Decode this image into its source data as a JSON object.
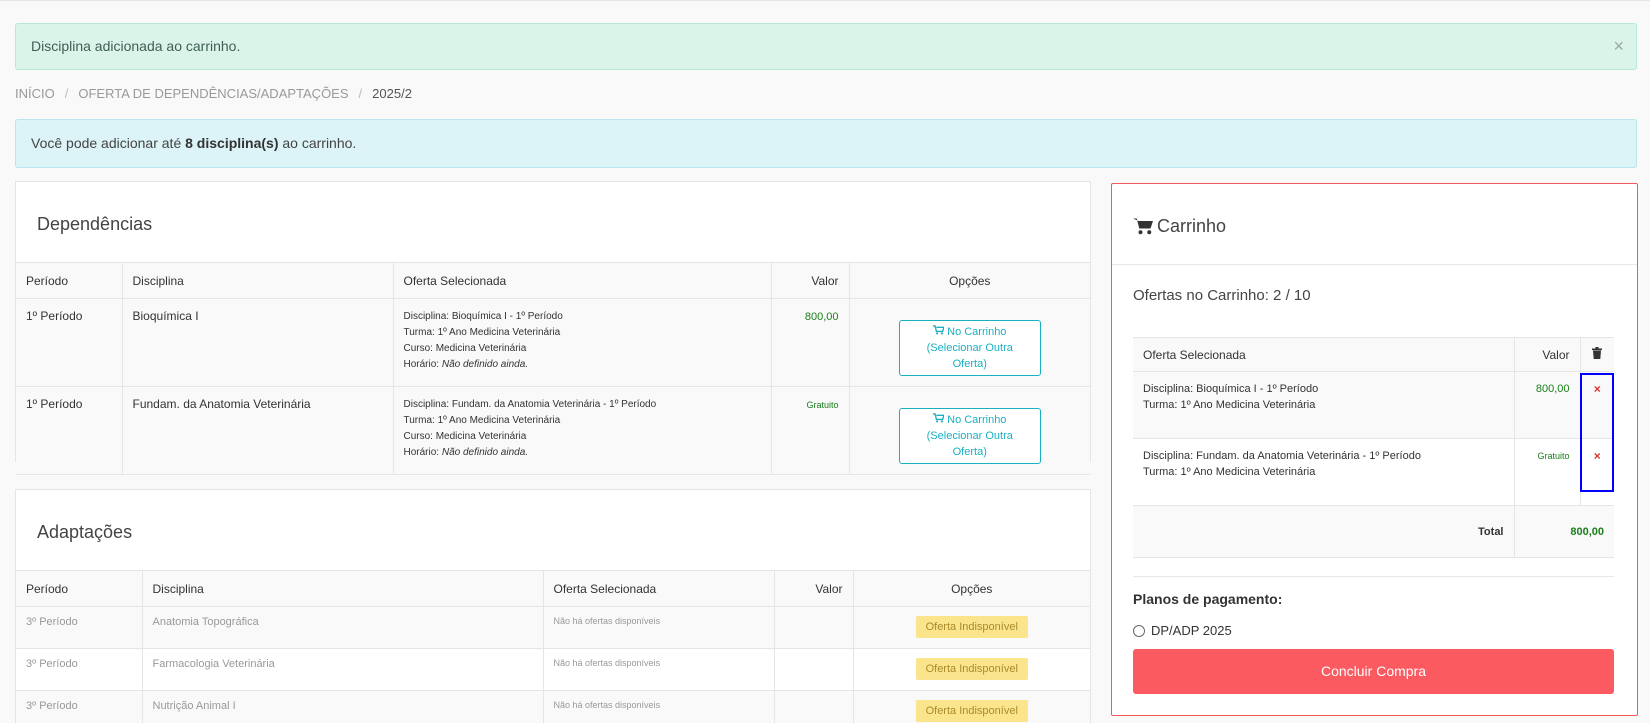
{
  "alert_success": {
    "text": "Disciplina adicionada ao carrinho.",
    "close_glyph": "×"
  },
  "breadcrumb": [
    "INÍCIO",
    "OFERTA DE DEPENDÊNCIAS/ADAPTAÇÕES",
    "2025/2"
  ],
  "breadcrumb_sep": "/",
  "info": {
    "prefix": "Você pode adicionar até ",
    "bold": "8 disciplina(s)",
    "suffix": " ao carrinho."
  },
  "dependencias": {
    "title": "Dependências",
    "headers": [
      "Período",
      "Disciplina",
      "Oferta Selecionada",
      "Valor",
      "Opções"
    ],
    "rows": [
      {
        "periodo": "1º Período",
        "disciplina": "Bioquímica I",
        "oferta": {
          "disciplina": "Disciplina: Bioquímica I - 1º Período",
          "turma": "Turma: 1º Ano Medicina Veterinária",
          "curso": "Curso: Medicina Veterinária",
          "horario_label": "Horário: ",
          "horario_value": "Não definido ainda."
        },
        "valor": "800,00",
        "btn_line1": "No Carrinho",
        "btn_line2": "(Selecionar Outra Oferta)"
      },
      {
        "periodo": "1º Período",
        "disciplina": "Fundam. da Anatomia Veterinária",
        "oferta": {
          "disciplina": "Disciplina: Fundam. da Anatomia Veterinária - 1º Período",
          "turma": "Turma: 1º Ano Medicina Veterinária",
          "curso": "Curso: Medicina Veterinária",
          "horario_label": "Horário: ",
          "horario_value": "Não definido ainda."
        },
        "valor": "Gratuito",
        "btn_line1": "No Carrinho",
        "btn_line2": "(Selecionar Outra Oferta)"
      }
    ]
  },
  "adaptacoes": {
    "title": "Adaptações",
    "headers": [
      "Período",
      "Disciplina",
      "Oferta Selecionada",
      "Valor",
      "Opções"
    ],
    "rows": [
      {
        "periodo": "3º Período",
        "disciplina": "Anatomia Topográfica",
        "oferta": "Não há ofertas disponíveis",
        "valor": "",
        "opcao": "Oferta Indisponível"
      },
      {
        "periodo": "3º Período",
        "disciplina": "Farmacologia Veterinária",
        "oferta": "Não há ofertas disponíveis",
        "valor": "",
        "opcao": "Oferta Indisponível"
      },
      {
        "periodo": "3º Período",
        "disciplina": "Nutrição Animal I",
        "oferta": "Não há ofertas disponíveis",
        "valor": "",
        "opcao": "Oferta Indisponível"
      }
    ]
  },
  "cart": {
    "title": "Carrinho",
    "count_label": "Ofertas no Carrinho: 2 / 10",
    "headers": [
      "Oferta Selecionada",
      "Valor"
    ],
    "items": [
      {
        "disciplina": "Disciplina: Bioquímica I - 1º Período",
        "turma": "Turma: 1º Ano Medicina Veterinária",
        "valor": "800,00",
        "remove": "×"
      },
      {
        "disciplina": "Disciplina: Fundam. da Anatomia Veterinária - 1º Período",
        "turma": "Turma: 1º Ano Medicina Veterinária",
        "valor": "Gratuito",
        "remove": "×"
      }
    ],
    "total_label": "Total",
    "total_value": "800,00",
    "plans_title": "Planos de pagamento:",
    "plan_option": "DP/ADP 2025",
    "buy_button": "Concluir Compra"
  },
  "colors": {
    "accent_cyan": "#1ab0c4",
    "danger": "#fa5a60",
    "success_green": "#1a7f1a",
    "highlight": "#0000ff"
  },
  "icons": [
    "cart-icon",
    "trash-icon",
    "close-icon",
    "remove-x-icon",
    "radio-icon"
  ]
}
